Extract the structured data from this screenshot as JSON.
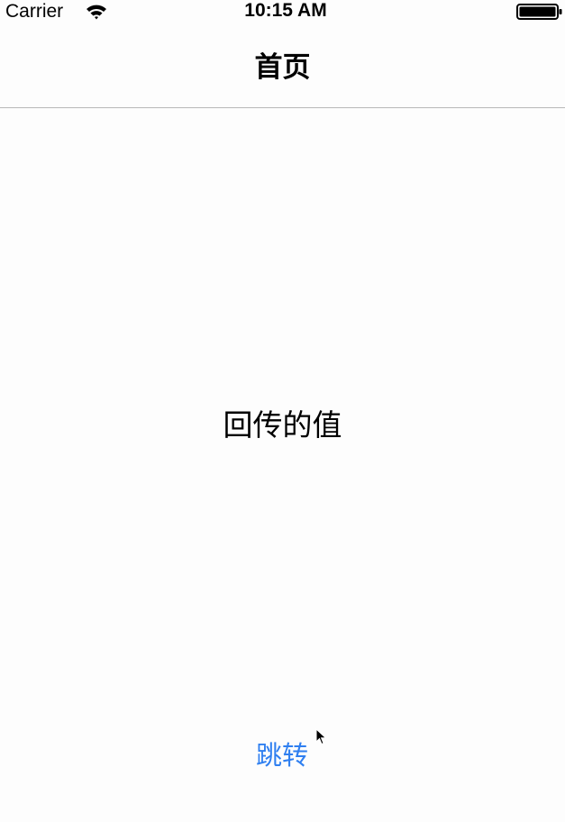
{
  "status_bar": {
    "carrier": "Carrier",
    "time": "10:15 AM",
    "icons": [
      "wifi-icon",
      "battery-icon"
    ]
  },
  "nav_bar": {
    "title": "首页"
  },
  "main": {
    "value_label": "回传的值",
    "jump_button_label": "跳转"
  },
  "colors": {
    "accent": "#2f7ff0",
    "background": "#fdfdfd",
    "divider": "#b8b8b8"
  }
}
